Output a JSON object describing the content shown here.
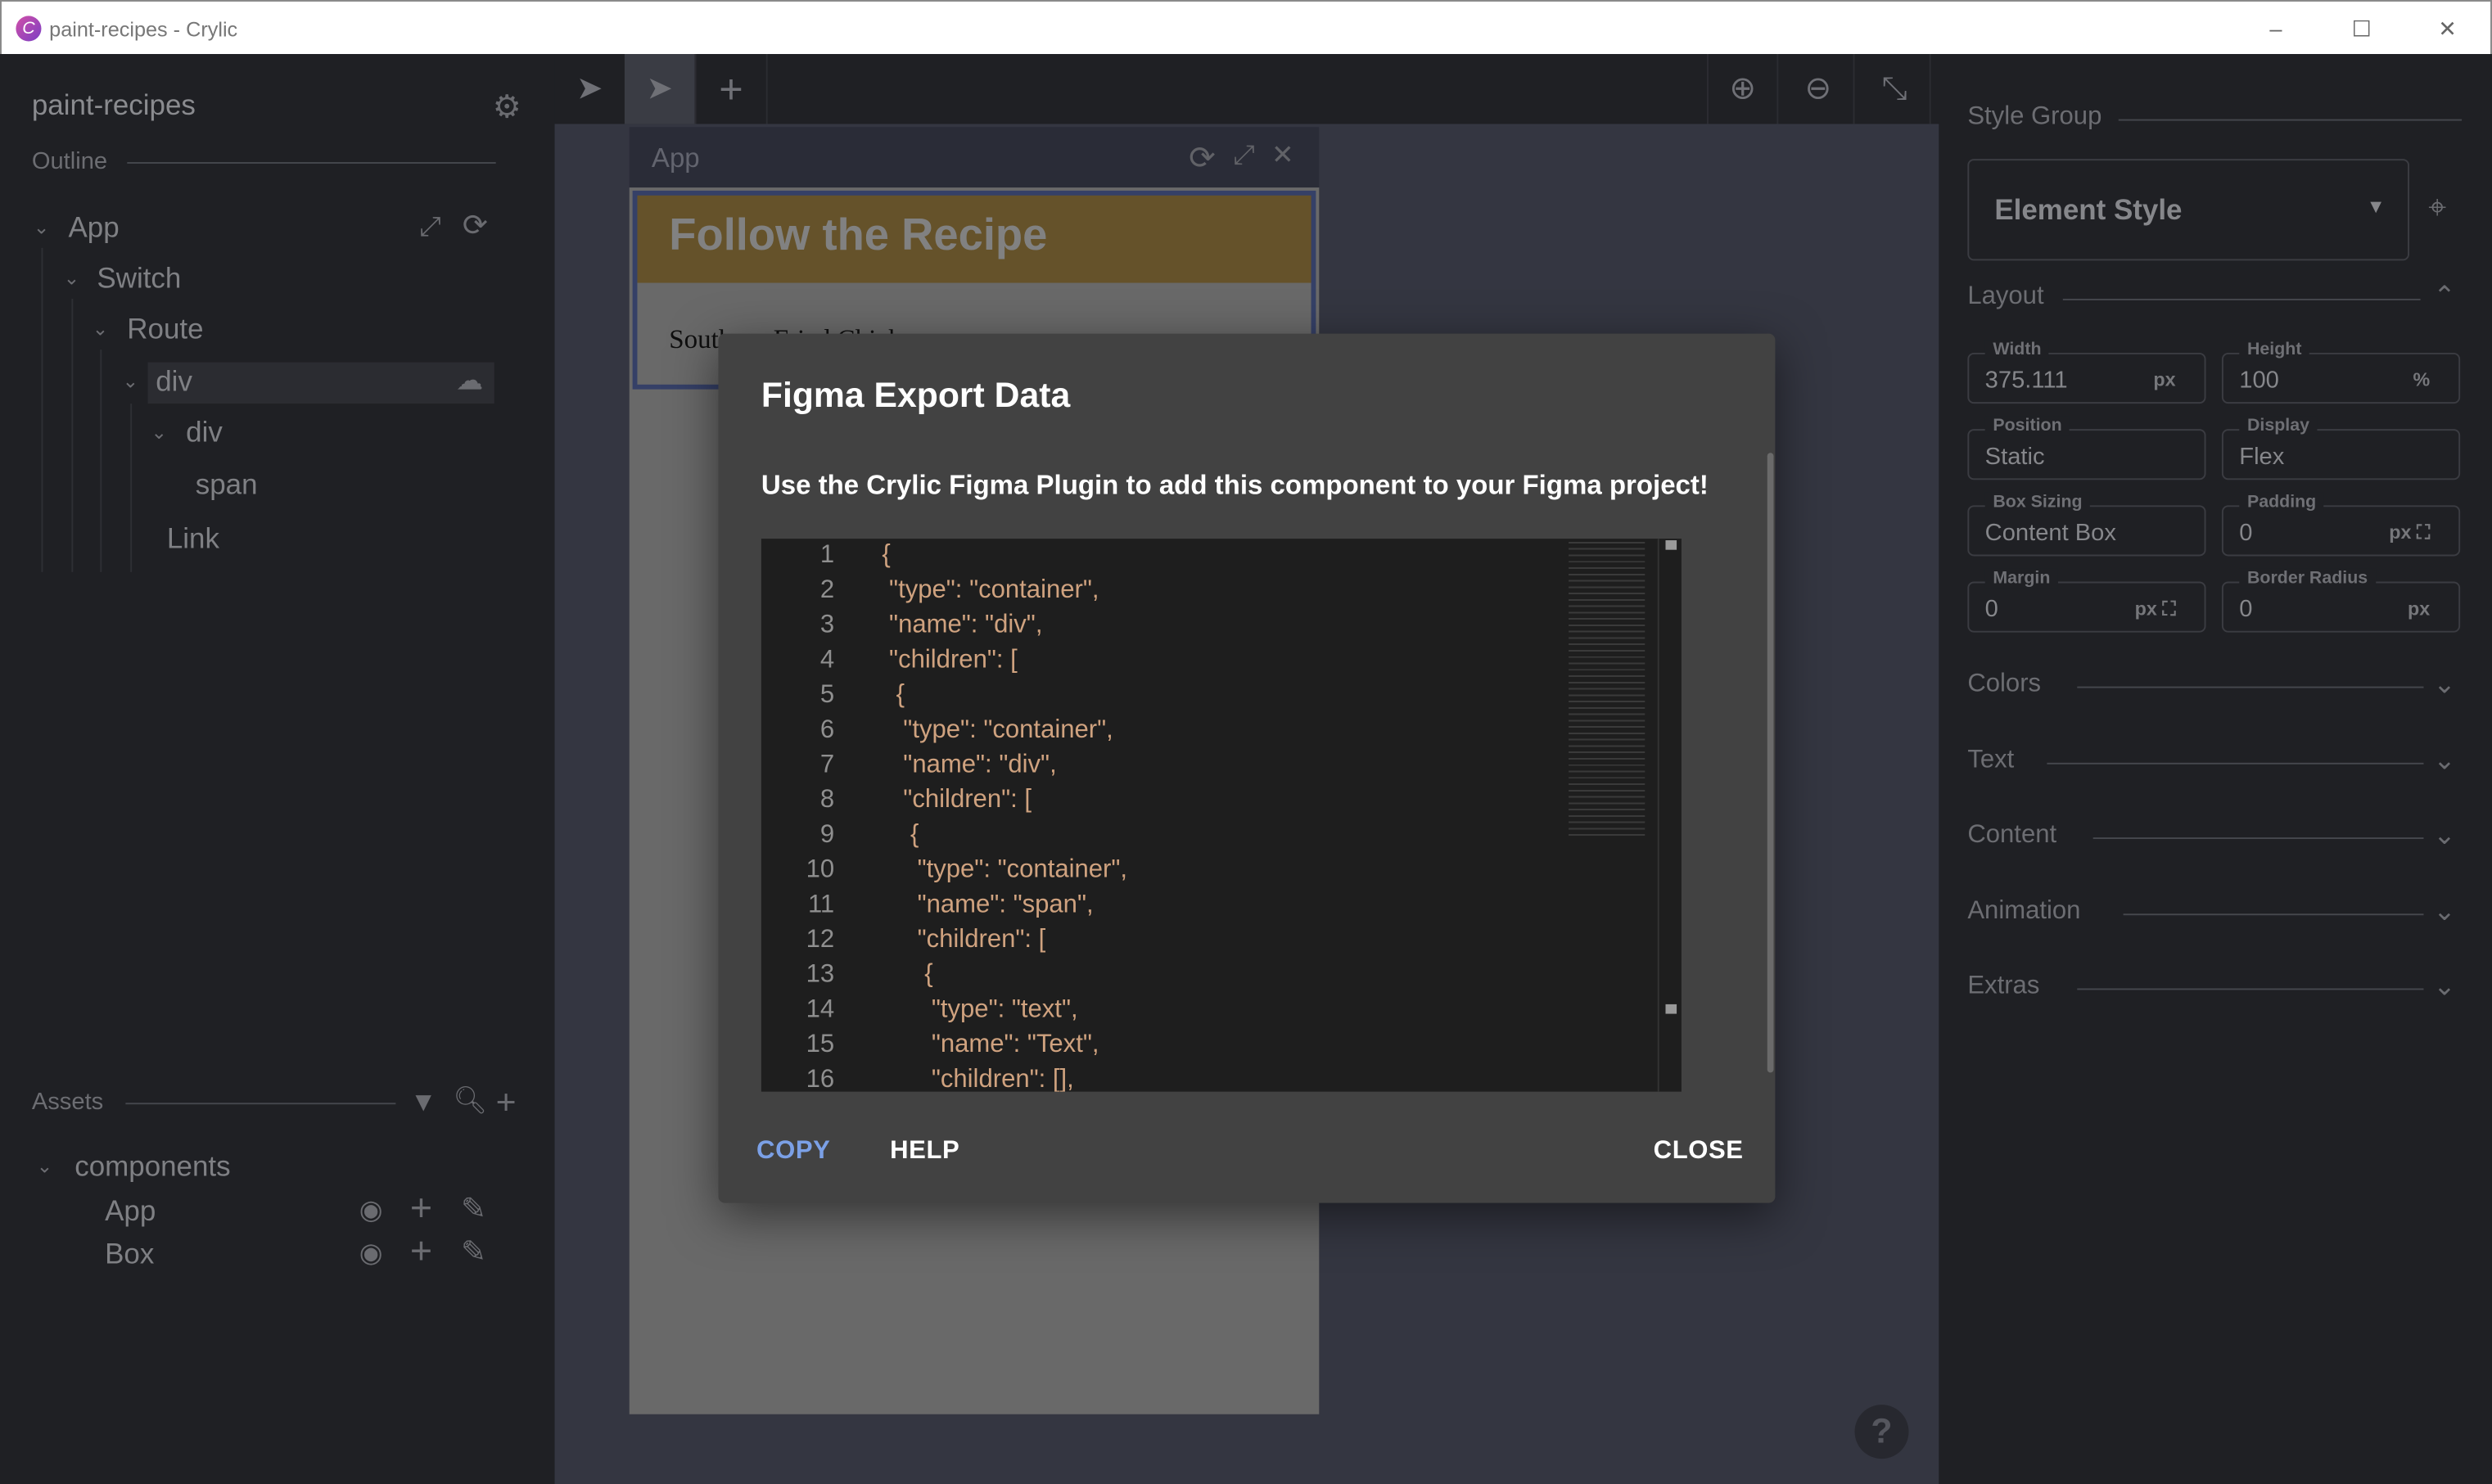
{
  "window": {
    "title": "paint-recipes - Crylic",
    "logo_letter": "C",
    "controls": [
      "–",
      "☐",
      "✕"
    ]
  },
  "sidebar": {
    "project": "paint-recipes",
    "outline_label": "Outline",
    "tree": [
      {
        "label": "App",
        "expanded": true
      },
      {
        "label": "Switch",
        "expanded": true
      },
      {
        "label": "Route",
        "expanded": true
      },
      {
        "label": "div",
        "expanded": true,
        "selected": true
      },
      {
        "label": "div",
        "expanded": true
      },
      {
        "label": "span"
      },
      {
        "label": "Link"
      }
    ],
    "assets_label": "Assets",
    "assets": {
      "group": "components",
      "items": [
        "App",
        "Box"
      ]
    }
  },
  "toolbar": {
    "tools": [
      "select-tool",
      "pointer-tool",
      "add-tool"
    ],
    "active_tool": "pointer-tool",
    "zoom": [
      "zoom-in",
      "zoom-out",
      "fit-screen"
    ]
  },
  "canvas": {
    "frame_title": "App",
    "heading": "Follow the Recipe",
    "body_text": "Southern Fried Chicken",
    "help": "?"
  },
  "dialog": {
    "title": "Figma Export Data",
    "subtitle": "Use the Crylic Figma Plugin to add this component to your Figma project!",
    "code": [
      {
        "n": "1",
        "text": "{"
      },
      {
        "n": "2",
        "text": " \"type\": \"container\","
      },
      {
        "n": "3",
        "text": " \"name\": \"div\","
      },
      {
        "n": "4",
        "text": " \"children\": ["
      },
      {
        "n": "5",
        "text": "  {"
      },
      {
        "n": "6",
        "text": "   \"type\": \"container\","
      },
      {
        "n": "7",
        "text": "   \"name\": \"div\","
      },
      {
        "n": "8",
        "text": "   \"children\": ["
      },
      {
        "n": "9",
        "text": "    {"
      },
      {
        "n": "10",
        "text": "     \"type\": \"container\","
      },
      {
        "n": "11",
        "text": "     \"name\": \"span\","
      },
      {
        "n": "12",
        "text": "     \"children\": ["
      },
      {
        "n": "13",
        "text": "      {"
      },
      {
        "n": "14",
        "text": "       \"type\": \"text\","
      },
      {
        "n": "15",
        "text": "       \"name\": \"Text\","
      },
      {
        "n": "16",
        "text": "       \"children\": [],"
      }
    ],
    "copy": "COPY",
    "help": "HELP",
    "close": "CLOSE",
    "colors": {
      "copy": "#7ba0e6",
      "string": "#cfa27f"
    }
  },
  "style_panel": {
    "style_group_label": "Style Group",
    "style_group_value": "Element Style",
    "layout_label": "Layout",
    "fields": [
      {
        "label": "Width",
        "value": "375.111",
        "unit": "px"
      },
      {
        "label": "Height",
        "value": "100",
        "unit": "%"
      },
      {
        "label": "Position",
        "value": "Static",
        "unit": ""
      },
      {
        "label": "Display",
        "value": "Flex",
        "unit": ""
      },
      {
        "label": "Box Sizing",
        "value": "Content Box",
        "unit": ""
      },
      {
        "label": "Padding",
        "value": "0",
        "unit": "px ⛶"
      },
      {
        "label": "Margin",
        "value": "0",
        "unit": "px ⛶"
      },
      {
        "label": "Border Radius",
        "value": "0",
        "unit": "px"
      }
    ],
    "sections": [
      "Colors",
      "Text",
      "Content",
      "Animation",
      "Extras"
    ]
  }
}
